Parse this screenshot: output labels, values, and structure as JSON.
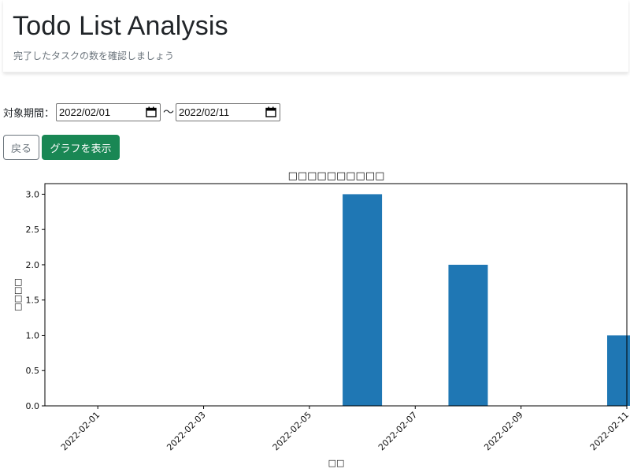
{
  "header": {
    "title": "Todo List Analysis",
    "subtitle": "完了したタスクの数を確認しましょう"
  },
  "filter": {
    "label": "対象期間：",
    "start_date": "2022/02/01",
    "separator": "～",
    "end_date": "2022/02/11"
  },
  "buttons": {
    "back": "戻る",
    "show_graph": "グラフを表示"
  },
  "chart_data": {
    "type": "bar",
    "title": "□□□□□□□□□□",
    "xlabel": "□□",
    "ylabel": "□□□□",
    "x": [
      "2022-02-06",
      "2022-02-08",
      "2022-02-11"
    ],
    "values": [
      3,
      2,
      1
    ],
    "x_ticks": [
      "2022-02-01",
      "2022-02-03",
      "2022-02-05",
      "2022-02-07",
      "2022-02-09",
      "2022-02-11"
    ],
    "y_ticks": [
      "0.0",
      "0.5",
      "1.0",
      "1.5",
      "2.0",
      "2.5",
      "3.0"
    ],
    "ylim": [
      0,
      3.15
    ],
    "xlim": [
      "2022-01-31",
      "2022-02-11"
    ],
    "grid": false,
    "bar_color": "#1f77b4"
  }
}
